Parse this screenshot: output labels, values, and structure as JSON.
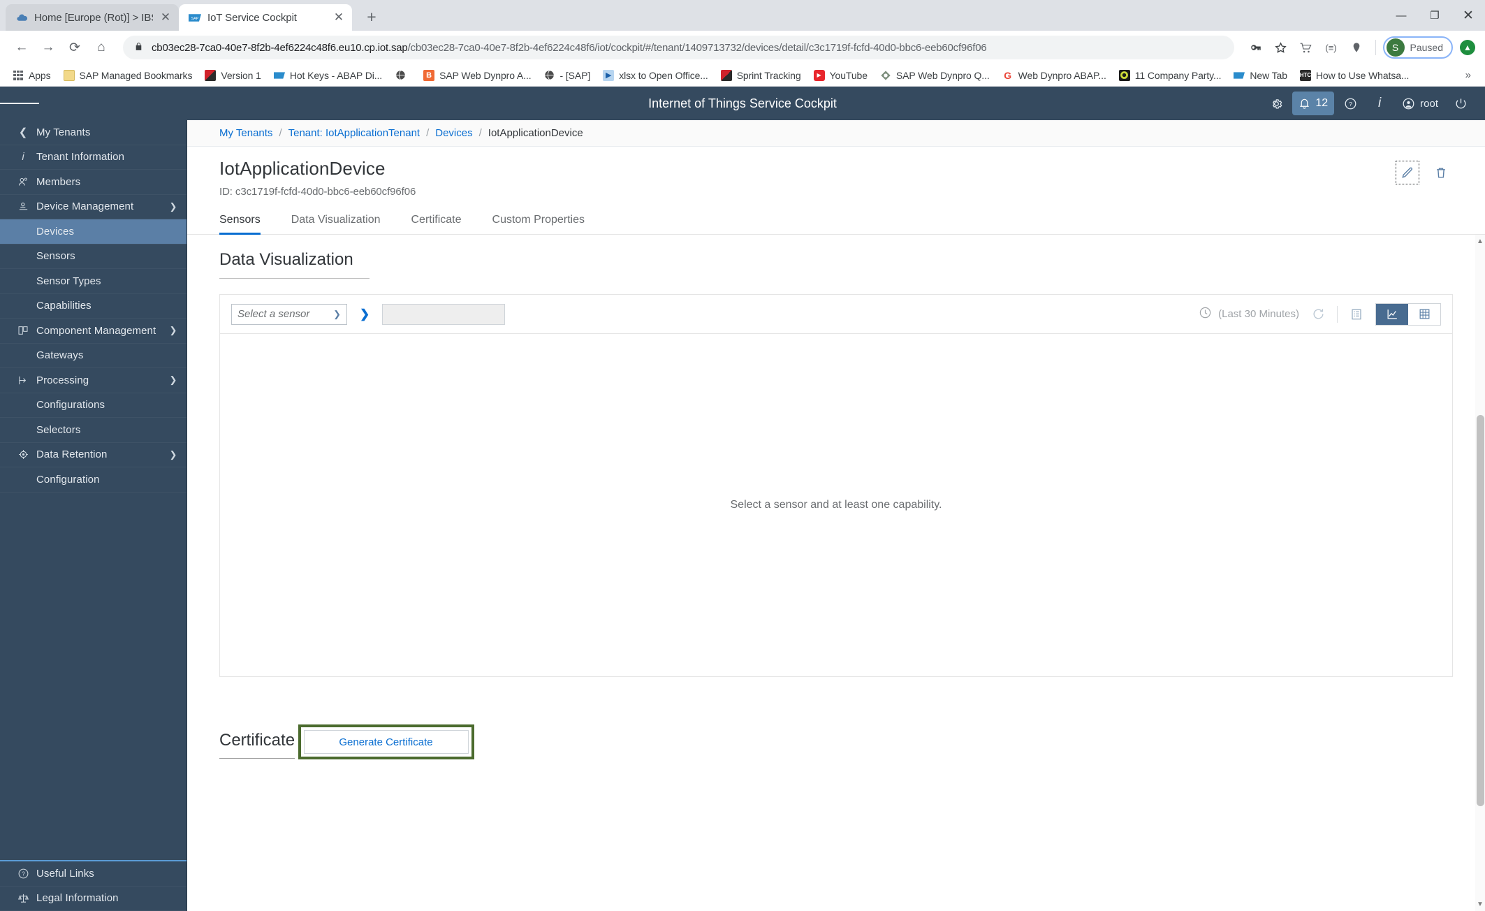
{
  "browser": {
    "tabs": [
      {
        "title": "Home [Europe (Rot)] > IBSO-ATC",
        "favicon": "cloud-icon",
        "active": false
      },
      {
        "title": "IoT Service Cockpit",
        "favicon": "sap-icon",
        "active": true
      }
    ],
    "new_tab_label": "+",
    "window_controls": {
      "minimize": "—",
      "maximize": "❐",
      "close": "✕"
    },
    "nav": {
      "back": "←",
      "forward": "→",
      "reload": "⟳",
      "home": "⌂"
    },
    "url": {
      "host": "cb03ec28-7ca0-40e7-8f2b-4ef6224c48f6.eu10.cp.iot.sap",
      "path": "/cb03ec28-7ca0-40e7-8f2b-4ef6224c48f6/iot/cockpit/#/tenant/1409713732/devices/detail/c3c1719f-fcfd-40d0-bbc6-eeb60cf96f06",
      "lock": "lock-icon"
    },
    "omni_icons": [
      "key-icon",
      "star-icon",
      "cart-icon",
      "extension-icon",
      "location-pin-icon"
    ],
    "profile": {
      "initial": "S",
      "status": "Paused"
    },
    "update_icon": "update-arrow-icon",
    "bookmarks": [
      {
        "label": "Apps",
        "icon": "apps-grid-icon"
      },
      {
        "label": "SAP Managed Bookmarks",
        "icon": "folder-icon"
      },
      {
        "label": "Version 1",
        "icon": "flag-icon"
      },
      {
        "label": "Hot Keys - ABAP Di...",
        "icon": "sap-icon"
      },
      {
        "label": "",
        "icon": "globe-icon"
      },
      {
        "label": "SAP Web Dynpro A...",
        "icon": "blogger-icon"
      },
      {
        "label": "- [SAP]",
        "icon": "globe-icon"
      },
      {
        "label": "xlsx to Open Office...",
        "icon": "blue-arrow-icon"
      },
      {
        "label": "Sprint Tracking",
        "icon": "flag-icon"
      },
      {
        "label": "YouTube",
        "icon": "youtube-icon"
      },
      {
        "label": "SAP Web Dynpro Q...",
        "icon": "diamond-icon"
      },
      {
        "label": "Web Dynpro ABAP...",
        "icon": "google-icon"
      },
      {
        "label": "11 Company Party...",
        "icon": "target-icon"
      },
      {
        "label": "New Tab",
        "icon": "sap-icon"
      },
      {
        "label": "How to Use Whatsa...",
        "icon": "htc-icon"
      }
    ],
    "bookmarks_overflow": "»"
  },
  "app_header": {
    "menu_icon": "hamburger-icon",
    "title": "Internet of Things Service Cockpit",
    "actions": [
      {
        "name": "settings",
        "icon": "gear-icon",
        "label": ""
      },
      {
        "name": "notifications",
        "icon": "bell-icon",
        "label": "12"
      },
      {
        "name": "help",
        "icon": "question-icon",
        "label": ""
      },
      {
        "name": "info",
        "icon": "info-icon",
        "label": ""
      },
      {
        "name": "user",
        "icon": "user-icon",
        "label": "root"
      },
      {
        "name": "logout",
        "icon": "power-icon",
        "label": ""
      }
    ]
  },
  "sidebar": {
    "items": [
      {
        "label": "My Tenants",
        "icon": "chevron-left-icon",
        "level": 0,
        "expandable": false,
        "active": false
      },
      {
        "label": "Tenant Information",
        "icon": "info-icon",
        "level": 0,
        "expandable": false,
        "active": false
      },
      {
        "label": "Members",
        "icon": "members-icon",
        "level": 0,
        "expandable": false,
        "active": false
      },
      {
        "label": "Device Management",
        "icon": "device-icon",
        "level": 0,
        "expandable": true,
        "active": false
      },
      {
        "label": "Devices",
        "icon": "",
        "level": 1,
        "expandable": false,
        "active": true
      },
      {
        "label": "Sensors",
        "icon": "",
        "level": 1,
        "expandable": false,
        "active": false
      },
      {
        "label": "Sensor Types",
        "icon": "",
        "level": 1,
        "expandable": false,
        "active": false
      },
      {
        "label": "Capabilities",
        "icon": "",
        "level": 1,
        "expandable": false,
        "active": false
      },
      {
        "label": "Component Management",
        "icon": "component-icon",
        "level": 0,
        "expandable": true,
        "active": false
      },
      {
        "label": "Gateways",
        "icon": "",
        "level": 1,
        "expandable": false,
        "active": false
      },
      {
        "label": "Processing",
        "icon": "processing-icon",
        "level": 0,
        "expandable": true,
        "active": false
      },
      {
        "label": "Configurations",
        "icon": "",
        "level": 1,
        "expandable": false,
        "active": false
      },
      {
        "label": "Selectors",
        "icon": "",
        "level": 1,
        "expandable": false,
        "active": false
      },
      {
        "label": "Data Retention",
        "icon": "retention-icon",
        "level": 0,
        "expandable": true,
        "active": false
      },
      {
        "label": "Configuration",
        "icon": "",
        "level": 1,
        "expandable": false,
        "active": false
      }
    ],
    "bottom_items": [
      {
        "label": "Useful Links",
        "icon": "question-circle-icon"
      },
      {
        "label": "Legal Information",
        "icon": "scales-icon"
      }
    ]
  },
  "breadcrumb": {
    "items": [
      {
        "label": "My Tenants",
        "link": true
      },
      {
        "label": "Tenant: IotApplicationTenant",
        "link": true
      },
      {
        "label": "Devices",
        "link": true
      },
      {
        "label": "IotApplicationDevice",
        "link": false
      }
    ],
    "separator": "/"
  },
  "object_header": {
    "title": "IotApplicationDevice",
    "id_label": "ID: c3c1719f-fcfd-40d0-bbc6-eeb60cf96f06",
    "edit_icon": "pencil-icon",
    "delete_icon": "trash-icon"
  },
  "tabs": [
    {
      "label": "Sensors",
      "active": true
    },
    {
      "label": "Data Visualization",
      "active": false
    },
    {
      "label": "Certificate",
      "active": false
    },
    {
      "label": "Custom Properties",
      "active": false
    }
  ],
  "data_visualization": {
    "section_title": "Data Visualization",
    "sensor_select": {
      "value": "Select a sensor",
      "chevron": "chevron-down-icon"
    },
    "go_arrow": "❯",
    "capability_field_value": "",
    "time_range": {
      "icon": "clock-icon",
      "label": "(Last 30 Minutes)"
    },
    "refresh_icon": "refresh-icon",
    "list_icon": "list-view-icon",
    "chart_icon": "chart-view-icon",
    "table_icon": "table-view-icon",
    "empty_message": "Select a sensor and at least one capability."
  },
  "certificate": {
    "section_title": "Certificate",
    "generate_button": "Generate Certificate"
  }
}
